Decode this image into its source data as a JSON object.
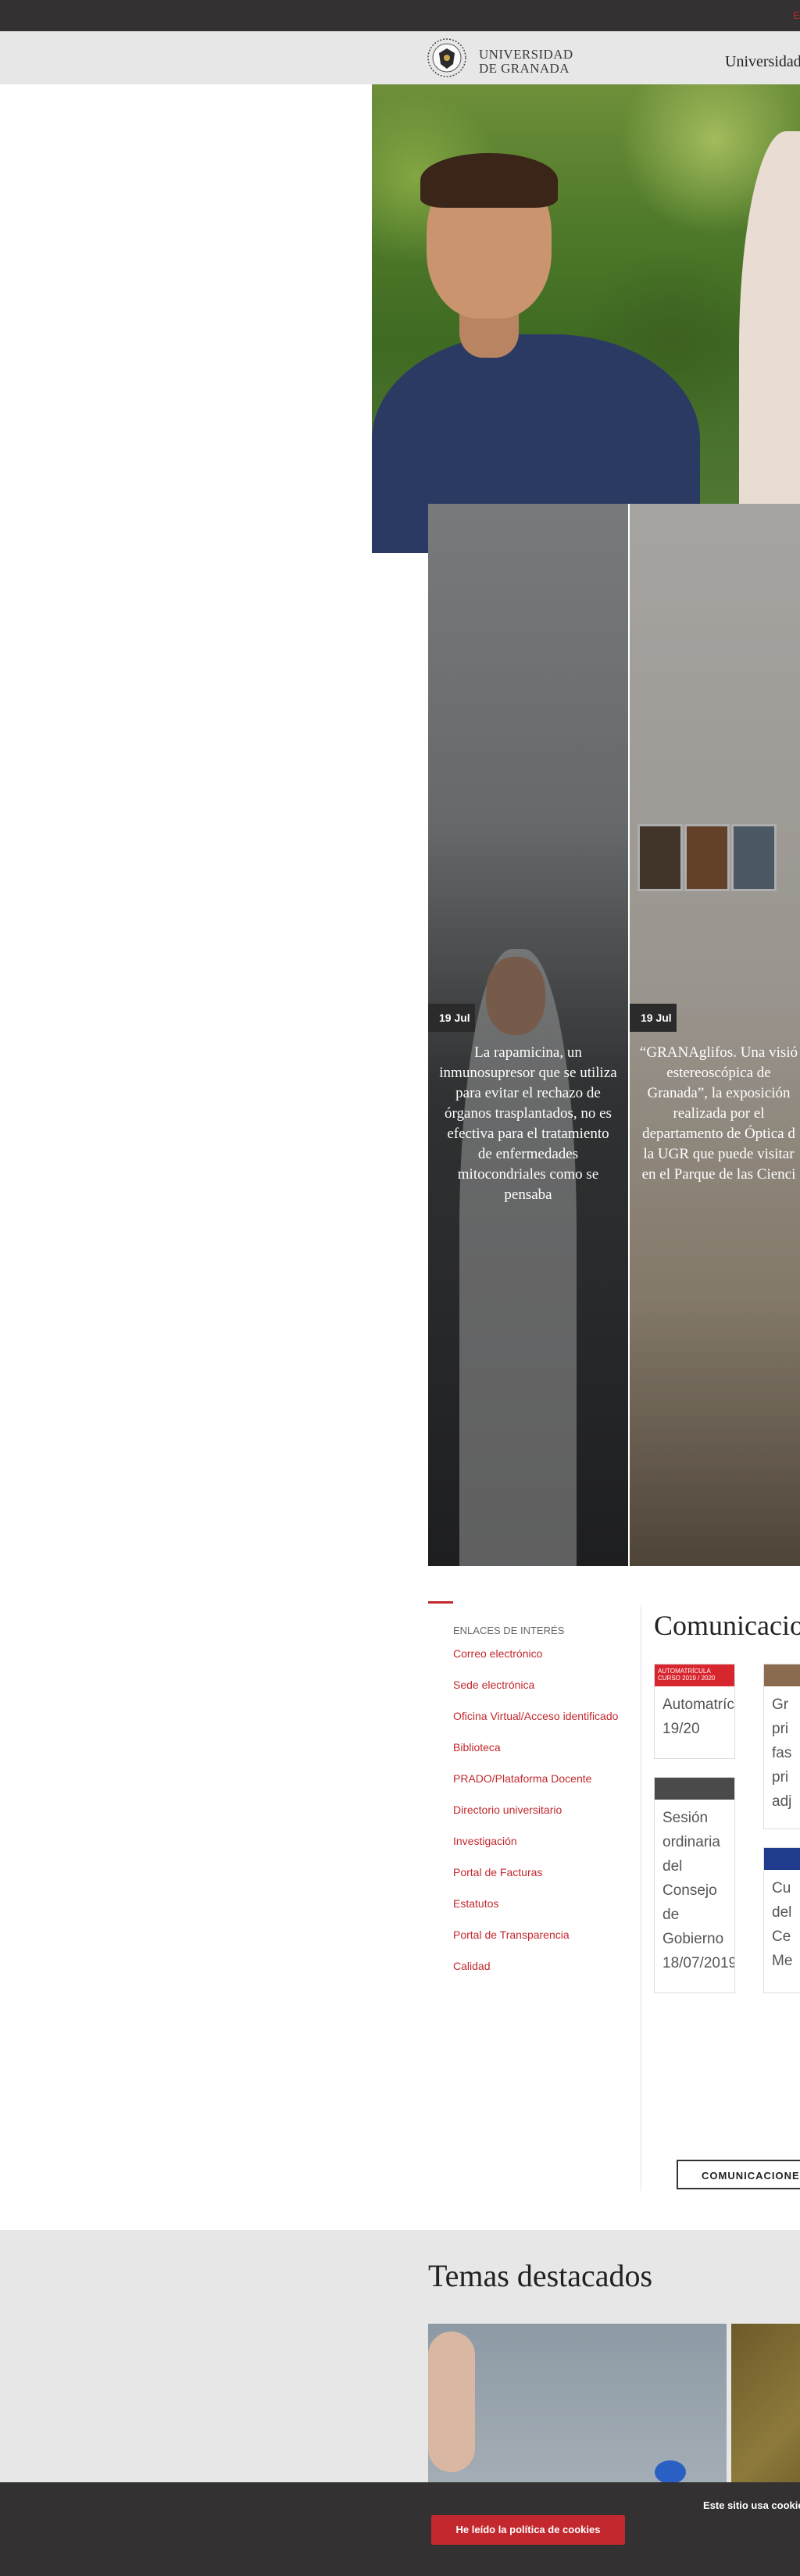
{
  "topbar": {
    "mark": "E"
  },
  "header": {
    "logo_line1": "UNIVERSIDAD",
    "logo_line2": "DE GRANADA",
    "nav_item": "Universidad"
  },
  "news": [
    {
      "date": "19 Jul",
      "title": "La rapamicina, un inmunosupresor que se utiliza para evitar el rechazo de órganos trasplantados, no es efectiva para el tratamiento de enfermedades mitocondriales como se pensaba"
    },
    {
      "date": "19 Jul",
      "title": "“GRANAglifos. Una visió estereoscópica de Granada”, la exposición realizada por el departamento de Óptica d la UGR que puede visitar en el Parque de las Cienci"
    }
  ],
  "links": {
    "title": "ENLACES DE INTERÉS",
    "items": [
      "Correo electrónico",
      "Sede electrónica",
      "Oficina Virtual/Acceso identificado",
      "Biblioteca",
      "PRADO/Plataforma Docente",
      "Directorio universitario",
      "Investigación",
      "Portal de Facturas",
      "Estatutos",
      "Portal de Transparencia",
      "Calidad"
    ]
  },
  "comunicaciones": {
    "title": "Comunicacion",
    "button": "COMUNICACIONE",
    "cards": [
      {
        "thumb": "AUTOMATRÍCULA CURSO 2019 / 2020",
        "text": "Automatrícula 19/20"
      },
      {
        "thumb": "",
        "text": "Gr pri fas pri adj"
      },
      {
        "thumb": "",
        "text": "Sesión ordinaria del Consejo de Gobierno 18/07/2019"
      },
      {
        "thumb": "",
        "text": "Cu del Ce Me"
      }
    ]
  },
  "temas": {
    "title": "Temas destacados"
  },
  "cookie": {
    "text": "Este sitio usa cookie",
    "button": "He leído la política de cookies"
  }
}
